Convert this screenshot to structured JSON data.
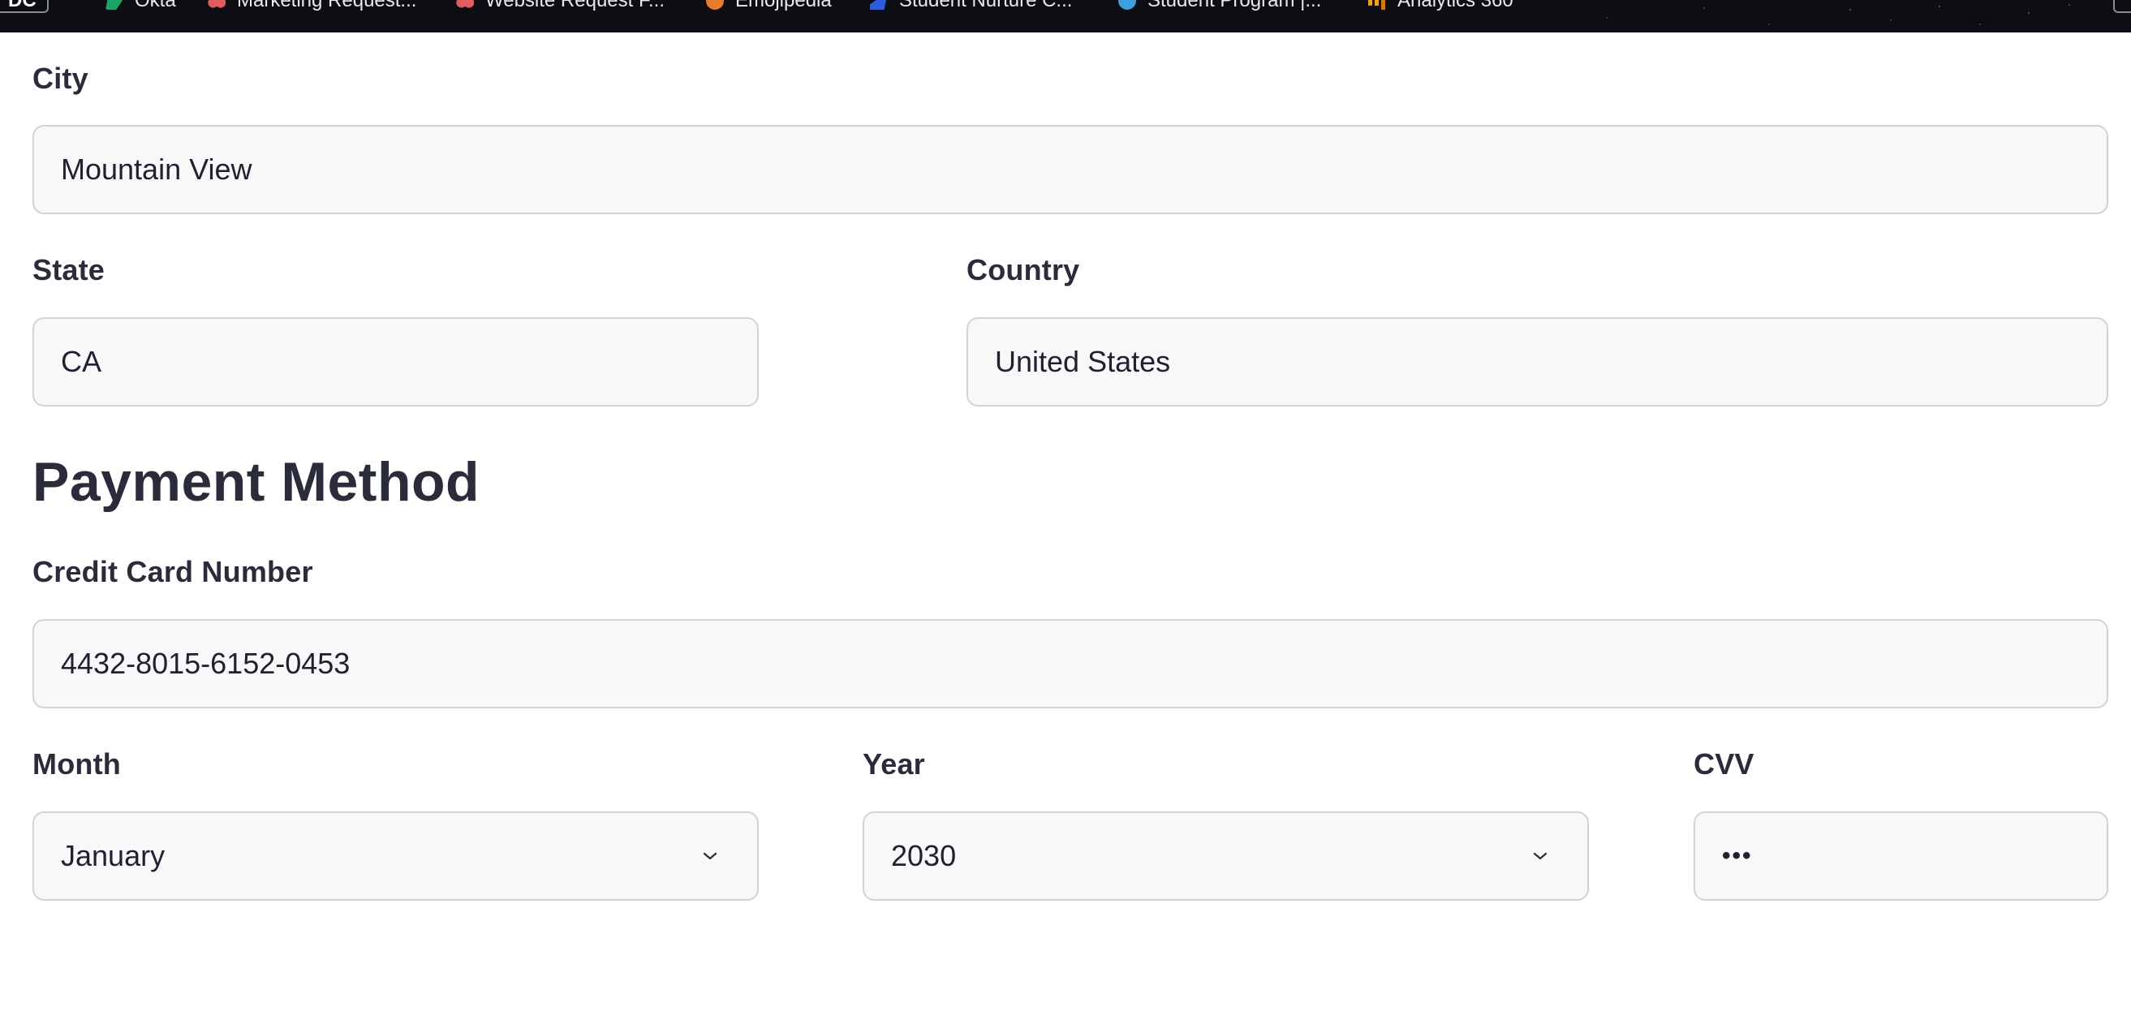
{
  "bookmarks": {
    "items": [
      {
        "label": "Okta",
        "icon": "okta-icon"
      },
      {
        "label": "Marketing Request...",
        "icon": "asana-icon"
      },
      {
        "label": "Website Request F...",
        "icon": "asana-icon"
      },
      {
        "label": "Emojipedia",
        "icon": "emojipedia-icon"
      },
      {
        "label": "Student Nurture C...",
        "icon": "wave-icon"
      },
      {
        "label": "Student Program |...",
        "icon": "cloud-icon"
      },
      {
        "label": "Analytics 360",
        "icon": "analytics-icon"
      }
    ],
    "edge_label": "DC"
  },
  "address": {
    "city": {
      "label": "City",
      "value": "Mountain View"
    },
    "state": {
      "label": "State",
      "value": "CA"
    },
    "country": {
      "label": "Country",
      "value": "United States"
    }
  },
  "payment": {
    "title": "Payment Method",
    "card_number": {
      "label": "Credit Card Number",
      "value": "4432-8015-6152-0453"
    },
    "month": {
      "label": "Month",
      "value": "January"
    },
    "year": {
      "label": "Year",
      "value": "2030"
    },
    "cvv": {
      "label": "CVV",
      "value": "•••"
    }
  },
  "colors": {
    "text": "#2a2c3b",
    "field_bg": "#f8f8f9",
    "field_border": "#d2d3d8",
    "bookmarks_bg": "#0c0e14"
  }
}
